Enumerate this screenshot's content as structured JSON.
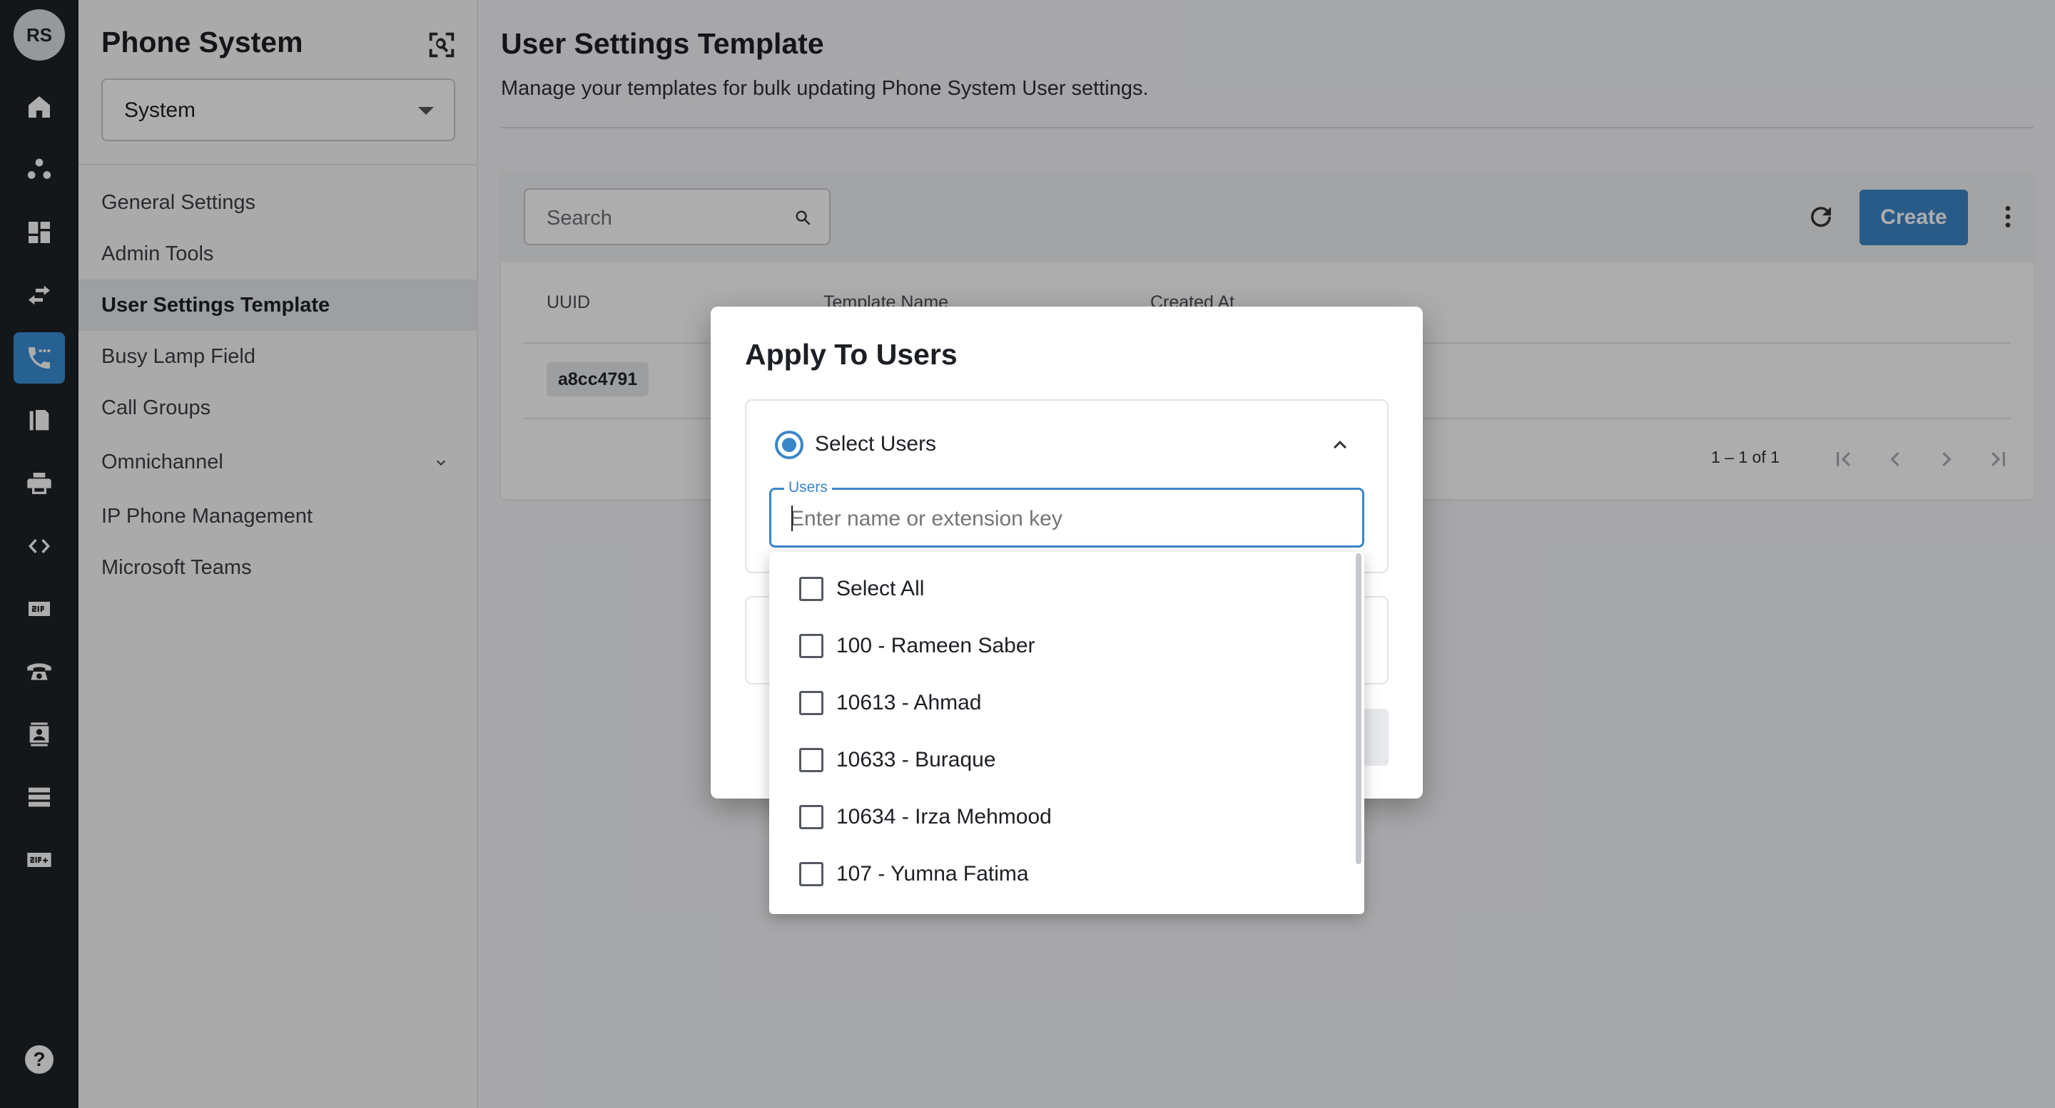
{
  "rail": {
    "avatar_initials": "RS",
    "items": [
      {
        "name": "home-icon"
      },
      {
        "name": "group-icon"
      },
      {
        "name": "dashboard-icon"
      },
      {
        "name": "transfer-icon"
      },
      {
        "name": "phone-dots-icon",
        "active": true
      },
      {
        "name": "fax-icon"
      },
      {
        "name": "printer-icon"
      },
      {
        "name": "code-icon"
      },
      {
        "name": "sip-icon"
      },
      {
        "name": "desk-phone-icon"
      },
      {
        "name": "contact-card-icon"
      },
      {
        "name": "server-icon"
      },
      {
        "name": "sip-plus-icon"
      }
    ],
    "help_label": "?"
  },
  "nav": {
    "title": "Phone System",
    "scope_select": "System",
    "items": [
      {
        "label": "General Settings"
      },
      {
        "label": "Admin Tools"
      },
      {
        "label": "User Settings Template",
        "active": true
      },
      {
        "label": "Busy Lamp Field"
      },
      {
        "label": "Call Groups"
      },
      {
        "label": "Omnichannel",
        "expandable": true
      },
      {
        "label": "IP Phone Management"
      },
      {
        "label": "Microsoft Teams"
      }
    ]
  },
  "main": {
    "title": "User Settings Template",
    "subtitle": "Manage your templates for bulk updating Phone System User settings.",
    "search_placeholder": "Search",
    "create_label": "Create",
    "columns": [
      "UUID",
      "Template Name",
      "Created At"
    ],
    "rows": [
      {
        "uuid": "a8cc4791"
      }
    ],
    "pagination": "1 – 1 of 1"
  },
  "dialog": {
    "title": "Apply To Users",
    "option_label": "Select Users",
    "users_field_label": "Users",
    "users_placeholder": "Enter name or extension key",
    "options": [
      {
        "label": "Select All"
      },
      {
        "label": "100 - Rameen Saber"
      },
      {
        "label": "10613 - Ahmad"
      },
      {
        "label": "10633 - Buraque"
      },
      {
        "label": "10634 - Irza Mehmood"
      },
      {
        "label": "107 - Yumna Fatima"
      }
    ]
  },
  "colors": {
    "rail_bg": "#1e2227",
    "accent": "#3b86c9",
    "active_rail": "#3a8fd6"
  }
}
